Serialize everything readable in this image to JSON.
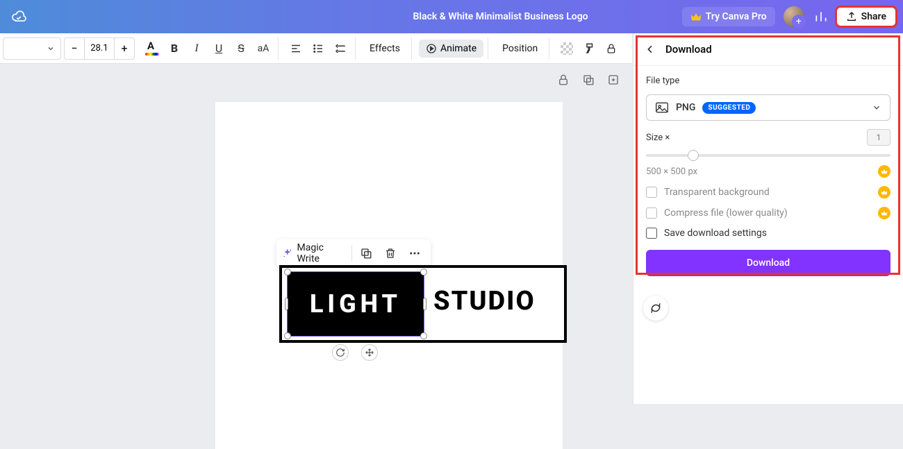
{
  "header": {
    "title": "Black & White Minimalist Business Logo",
    "try_pro": "Try Canva Pro",
    "share": "Share"
  },
  "toolbar": {
    "font_size": "28.1",
    "effects": "Effects",
    "animate": "Animate",
    "position": "Position"
  },
  "floating": {
    "magic_write": "Magic Write"
  },
  "logo": {
    "light": "LIGHT",
    "studio": "STUDIO"
  },
  "download": {
    "title": "Download",
    "file_type_label": "File type",
    "file_type": "PNG",
    "suggested": "SUGGESTED",
    "size_label": "Size ×",
    "size_value": "1",
    "dimensions": "500 × 500 px",
    "transparent": "Transparent background",
    "compress": "Compress file (lower quality)",
    "save_settings": "Save download settings",
    "button": "Download"
  }
}
